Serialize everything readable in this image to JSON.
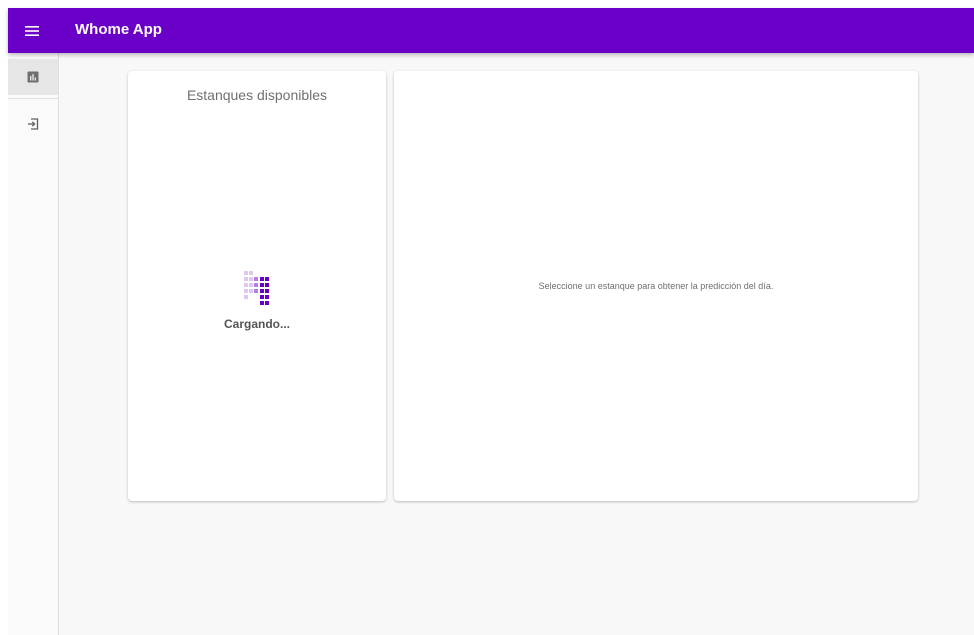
{
  "header": {
    "app_title": "Whome App",
    "menu_icon": "menu-icon",
    "background_color": "#6a00c7"
  },
  "sidebar": {
    "items": [
      {
        "icon": "bar-chart-icon",
        "active": true
      },
      {
        "icon": "logout-icon",
        "active": false
      }
    ]
  },
  "tanks_card": {
    "title": "Estanques disponibles",
    "loading_text": "Cargando...",
    "loader_icon": "loading-dots-icon",
    "loader_color": "#6a00c7"
  },
  "prediction_card": {
    "message": "Seleccione un estanque para obtener la predicción del día."
  }
}
